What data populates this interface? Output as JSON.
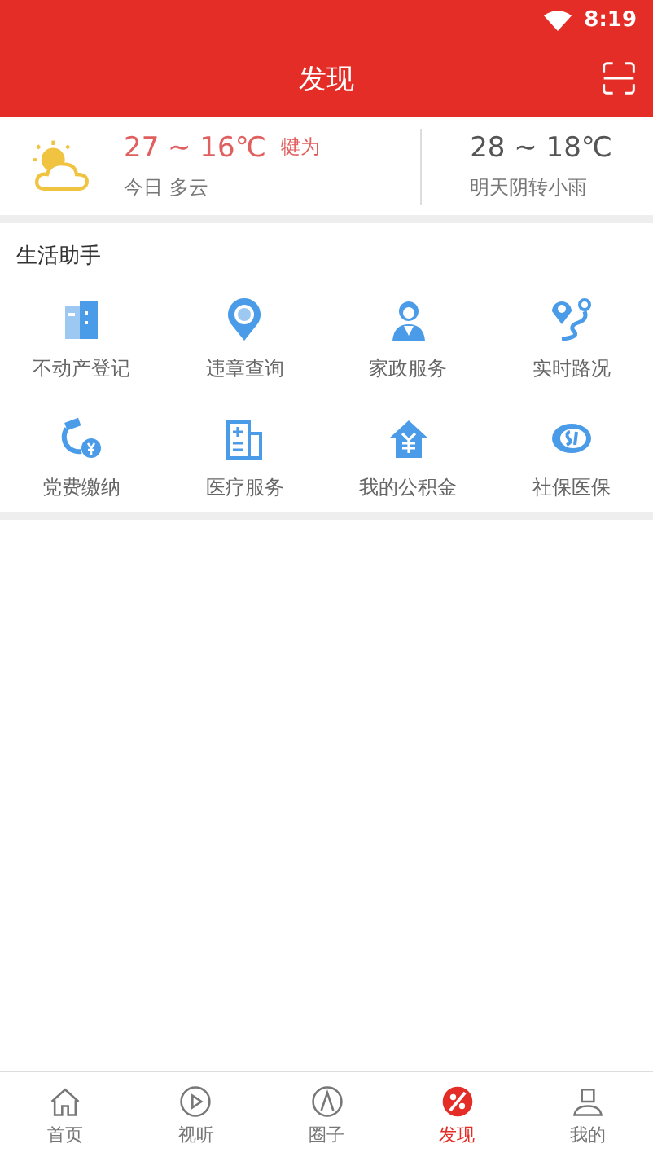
{
  "status_bar": {
    "time": "8:19"
  },
  "header": {
    "title": "发现"
  },
  "weather": {
    "today_temp": "27 ~ 16℃",
    "city": "犍为",
    "today_desc": "今日 多云",
    "tomorrow_temp": "28 ~ 18℃",
    "tomorrow_desc": "明天阴转小雨"
  },
  "section": {
    "title": "生活助手",
    "items": [
      {
        "label": "不动产登记"
      },
      {
        "label": "违章查询"
      },
      {
        "label": "家政服务"
      },
      {
        "label": "实时路况"
      },
      {
        "label": "党费缴纳"
      },
      {
        "label": "医疗服务"
      },
      {
        "label": "我的公积金"
      },
      {
        "label": "社保医保"
      }
    ]
  },
  "tabs": [
    {
      "label": "首页",
      "selected": false
    },
    {
      "label": "视听",
      "selected": false
    },
    {
      "label": "圈子",
      "selected": false
    },
    {
      "label": "发现",
      "selected": true
    },
    {
      "label": "我的",
      "selected": false
    }
  ]
}
